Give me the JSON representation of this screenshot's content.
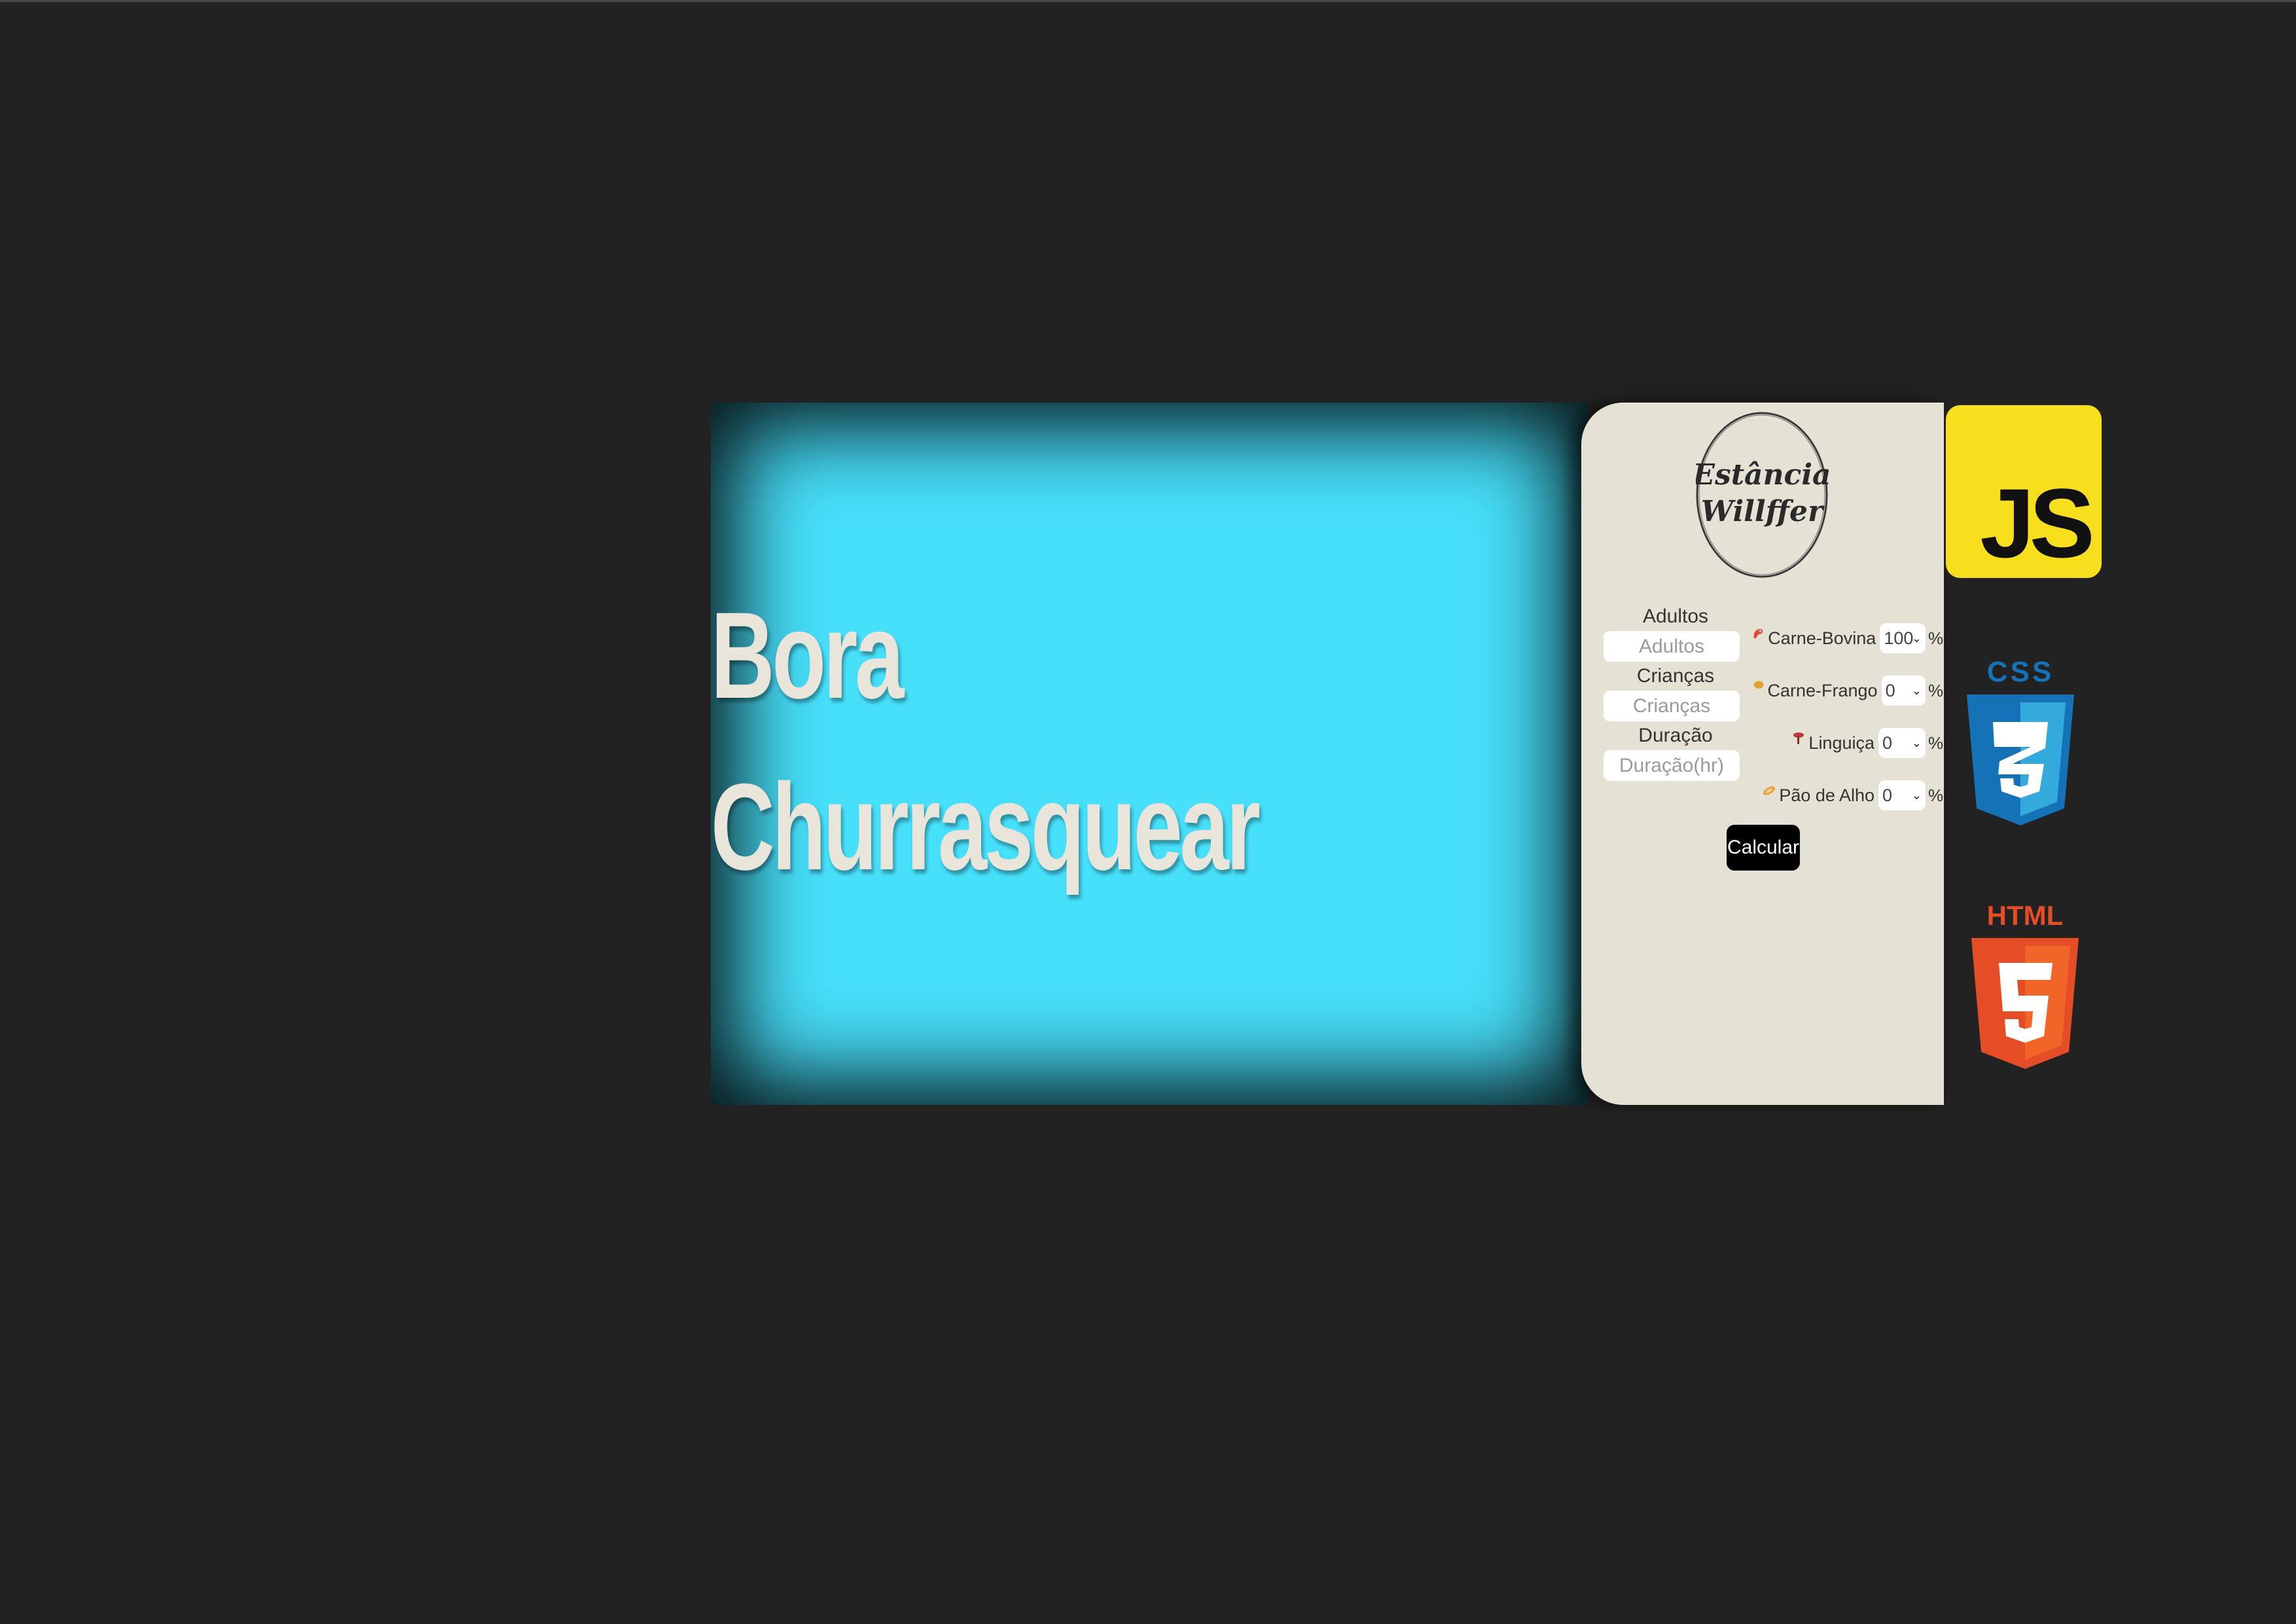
{
  "hero": {
    "title_line1": "Bora",
    "title_line2": "Churrasquear"
  },
  "logo": {
    "line1": "Estância",
    "line2": "Willffer"
  },
  "form": {
    "adults": {
      "label": "Adultos",
      "placeholder": "Adultos"
    },
    "children": {
      "label": "Crianças",
      "placeholder": "Crianças"
    },
    "duration": {
      "label": "Duração",
      "placeholder": "Duração(hr)"
    }
  },
  "meats": [
    {
      "label": "Carne-Bovina",
      "value": "100",
      "unit": "%",
      "icon": "beef-icon",
      "color": "#e0493a"
    },
    {
      "label": "Carne-Frango",
      "value": "0",
      "unit": "%",
      "icon": "chicken-leg-icon",
      "color": "#e0a030"
    },
    {
      "label": "Linguiça",
      "value": "0",
      "unit": "%",
      "icon": "sausage-icon",
      "color": "#c0393a"
    },
    {
      "label": "Pão de Alho",
      "value": "0",
      "unit": "%",
      "icon": "garlic-bread-icon",
      "color": "#e8a040"
    }
  ],
  "actions": {
    "calculate_label": "Calcular"
  },
  "badges": {
    "js": {
      "text": "JS",
      "color": "#f7df1e",
      "icon": "javascript-logo-icon"
    },
    "css": {
      "text": "CSS",
      "color": "#1572b6",
      "icon": "css3-logo-icon"
    },
    "html": {
      "text": "HTML",
      "color": "#e44d26",
      "icon": "html5-logo-icon"
    }
  },
  "colors": {
    "page_background": "#222222",
    "hero_background": "#47e0fb",
    "panel_background": "#e5e1d5",
    "hero_text": "#e9e5da"
  }
}
